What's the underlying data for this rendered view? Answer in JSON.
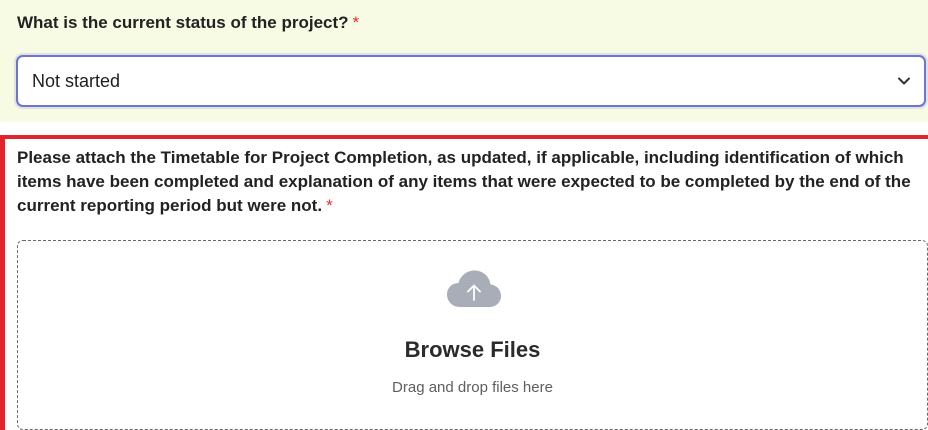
{
  "status_question": {
    "label": "What is the current status of the project?",
    "required_marker": "*",
    "select_value": "Not started"
  },
  "attach_question": {
    "label": "Please attach the Timetable for Project Completion, as updated, if applicable, including identification of which items have been completed and explanation of any items that were expected to be completed by the end of the current reporting period but were not.",
    "required_marker": "*"
  },
  "dropzone": {
    "browse_label": "Browse Files",
    "drag_label": "Drag and drop files here"
  },
  "icons": {
    "dropdown": "chevron-down-icon",
    "upload": "cloud-upload-icon"
  },
  "colors": {
    "highlight_background": "#f8fbe4",
    "select_border": "#6c75d1",
    "error_border": "#e3232c",
    "required_star": "#e0302f",
    "cloud_icon": "#a9adb8"
  }
}
